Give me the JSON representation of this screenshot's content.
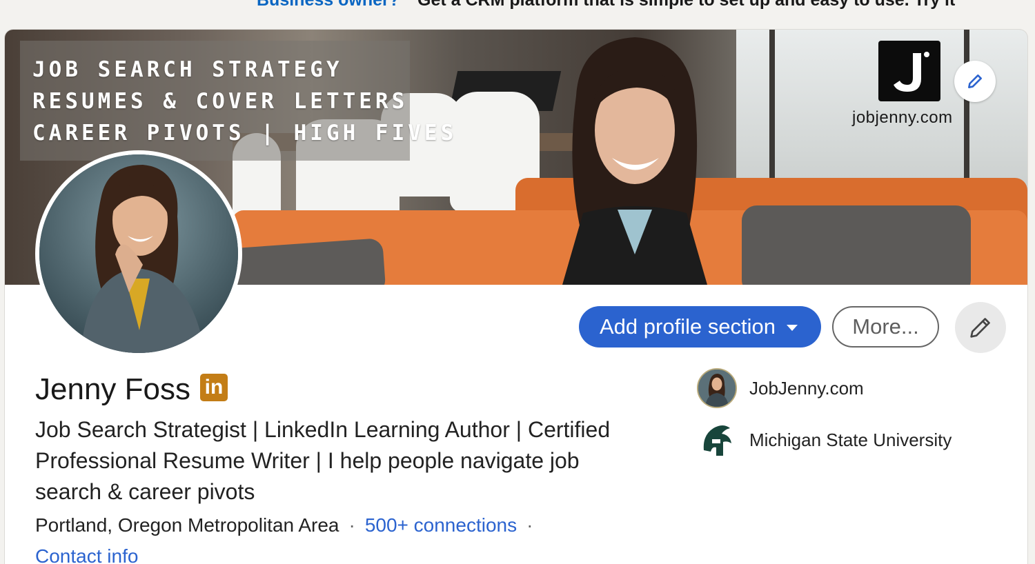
{
  "promo": {
    "link": "Business owner?",
    "text": "Get a CRM platform that is simple to set up and easy to use. Try it"
  },
  "banner": {
    "lines": [
      "JOB SEARCH STRATEGY",
      "RESUMES & COVER LETTERS",
      "CAREER PIVOTS | HIGH FIVES"
    ],
    "logo_letter": "J",
    "logo_text": "jobjenny.com"
  },
  "actions": {
    "add_section": "Add profile section",
    "more": "More..."
  },
  "profile": {
    "name": "Jenny Foss",
    "badge": "in",
    "headline": "Job Search Strategist | LinkedIn Learning Author | Certified Professional Resume Writer | I help people navigate job search & career pivots",
    "location": "Portland, Oregon Metropolitan Area",
    "separator": "·",
    "connections": "500+ connections",
    "contact": "Contact info"
  },
  "orgs": [
    {
      "name": "JobJenny.com",
      "icon": "company-logo"
    },
    {
      "name": "Michigan State University",
      "icon": "spartan-helmet-icon"
    }
  ],
  "colors": {
    "primary": "#2b63cf",
    "linkedin_badge": "#c37d16",
    "msu_green": "#18453b"
  }
}
